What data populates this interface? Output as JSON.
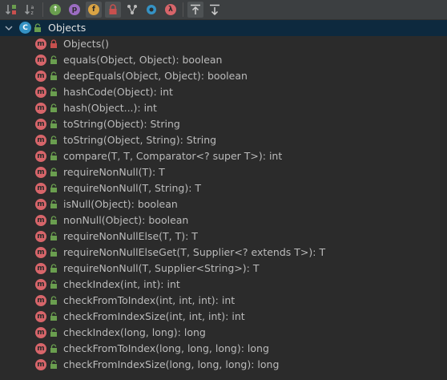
{
  "toolbar": {
    "buttons": [
      {
        "icon": "sort-by-visibility-icon"
      },
      {
        "icon": "sort-alphabetically-icon"
      },
      {
        "icon": "show-inherited-icon",
        "glyph": "↑"
      },
      {
        "icon": "show-properties-icon",
        "glyph": "p"
      },
      {
        "icon": "show-fields-icon",
        "glyph": "f"
      },
      {
        "icon": "show-non-public-icon"
      },
      {
        "icon": "show-inheritance-tree-icon"
      },
      {
        "icon": "show-anonymous-classes-icon"
      },
      {
        "icon": "show-lambdas-icon",
        "glyph": "λ"
      },
      {
        "icon": "autoscroll-to-source-icon"
      },
      {
        "icon": "autoscroll-from-source-icon"
      }
    ]
  },
  "tree": {
    "root": {
      "label": "Objects",
      "icon_letter": "C"
    },
    "members": [
      {
        "label": "Objects()",
        "visibility": "private"
      },
      {
        "label": "equals(Object, Object): boolean",
        "visibility": "public"
      },
      {
        "label": "deepEquals(Object, Object): boolean",
        "visibility": "public"
      },
      {
        "label": "hashCode(Object): int",
        "visibility": "public"
      },
      {
        "label": "hash(Object...): int",
        "visibility": "public"
      },
      {
        "label": "toString(Object): String",
        "visibility": "public"
      },
      {
        "label": "toString(Object, String): String",
        "visibility": "public"
      },
      {
        "label": "compare(T, T, Comparator<? super T>): int",
        "visibility": "public"
      },
      {
        "label": "requireNonNull(T): T",
        "visibility": "public"
      },
      {
        "label": "requireNonNull(T, String): T",
        "visibility": "public"
      },
      {
        "label": "isNull(Object): boolean",
        "visibility": "public"
      },
      {
        "label": "nonNull(Object): boolean",
        "visibility": "public"
      },
      {
        "label": "requireNonNullElse(T, T): T",
        "visibility": "public"
      },
      {
        "label": "requireNonNullElseGet(T, Supplier<? extends T>): T",
        "visibility": "public"
      },
      {
        "label": "requireNonNull(T, Supplier<String>): T",
        "visibility": "public"
      },
      {
        "label": "checkIndex(int, int): int",
        "visibility": "public"
      },
      {
        "label": "checkFromToIndex(int, int, int): int",
        "visibility": "public"
      },
      {
        "label": "checkFromIndexSize(int, int, int): int",
        "visibility": "public"
      },
      {
        "label": "checkIndex(long, long): long",
        "visibility": "public"
      },
      {
        "label": "checkFromToIndex(long, long, long): long",
        "visibility": "public"
      },
      {
        "label": "checkFromIndexSize(long, long, long): long",
        "visibility": "public"
      }
    ],
    "method_icon_letter": "m"
  },
  "colors": {
    "background": "#2b2b2b",
    "toolbar": "#3c3f41",
    "selected_row": "#0d293e",
    "method_icon": "#d7656a",
    "class_icon": "#3592c4",
    "public_lock": "#6a9e4f",
    "private_lock": "#c8504e"
  }
}
